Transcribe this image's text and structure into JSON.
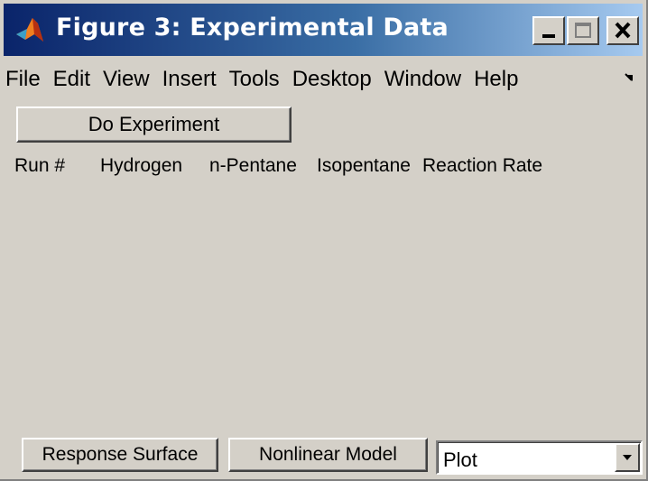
{
  "window": {
    "title": "Figure 3: Experimental Data",
    "icon": "matlab-logo-icon",
    "controls": [
      "minimize-icon",
      "maximize-icon",
      "close-icon"
    ]
  },
  "menubar": {
    "items": [
      {
        "label": "File"
      },
      {
        "label": "Edit"
      },
      {
        "label": "View"
      },
      {
        "label": "Insert"
      },
      {
        "label": "Tools"
      },
      {
        "label": "Desktop"
      },
      {
        "label": "Window"
      },
      {
        "label": "Help"
      }
    ],
    "overflow_icon": "toolbar-dock-arrow-icon"
  },
  "actions": {
    "do_experiment": "Do Experiment",
    "response_surface": "Response Surface",
    "nonlinear_model": "Nonlinear Model"
  },
  "table": {
    "columns": [
      "Run #",
      "Hydrogen",
      "n-Pentane",
      "Isopentane",
      "Reaction Rate"
    ],
    "rows": []
  },
  "plot_select": {
    "value": "Plot"
  },
  "colors": {
    "titlebar_start": "#0a246a",
    "titlebar_end": "#a6caf0",
    "face": "#d4d0c8"
  }
}
